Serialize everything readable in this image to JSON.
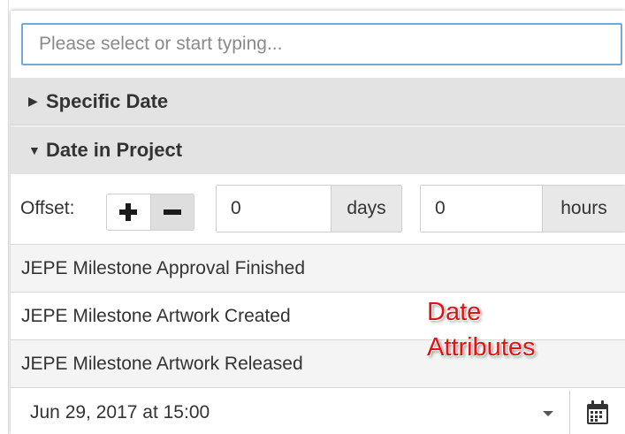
{
  "search": {
    "placeholder": "Please select or start typing..."
  },
  "sections": [
    {
      "title": "Specific Date",
      "expanded": false
    },
    {
      "title": "Date in Project",
      "expanded": true
    }
  ],
  "offset": {
    "label": "Offset:",
    "days_value": "0",
    "days_unit": "days",
    "hours_value": "0",
    "hours_unit": "hours",
    "selected_sign": "minus"
  },
  "list": {
    "items": [
      {
        "label": "JEPE Milestone Approval Finished"
      },
      {
        "label": "JEPE Milestone Artwork Created"
      },
      {
        "label": "JEPE Milestone Artwork Released"
      }
    ]
  },
  "date_field": {
    "value": "Jun 29, 2017 at 15:00"
  },
  "annotation": {
    "line1": "Date",
    "line2": "Attributes",
    "color": "#e01414"
  },
  "colors": {
    "focus_border": "#72a9d8",
    "section_bg": "#e3e3e3",
    "addon_bg": "#e8e8e8"
  },
  "icons": {
    "collapsed": "caret-right-icon",
    "expanded": "caret-down-icon",
    "add": "plus-icon",
    "subtract": "minus-icon",
    "calendar": "calendar-icon",
    "dropdown": "chevron-down-icon"
  }
}
